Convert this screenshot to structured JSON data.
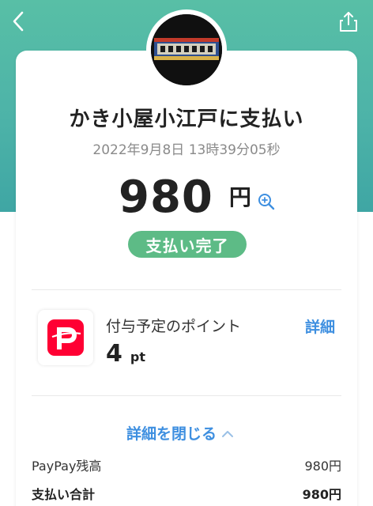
{
  "header": {
    "back_icon": "chevron-left-icon",
    "share_icon": "share-icon"
  },
  "merchant": {
    "title": "かき小屋小江戸に支払い",
    "logo_text": "かき小屋小江戸"
  },
  "transaction": {
    "timestamp": "2022年9月8日 13時39分05秒",
    "amount": "980",
    "currency": "円",
    "status": "支払い完了"
  },
  "points": {
    "label": "付与予定のポイント",
    "value": "4",
    "unit": "pt",
    "details_label": "詳細"
  },
  "details": {
    "toggle_label": "詳細を閉じる",
    "rows": [
      {
        "label": "PayPay残高",
        "value": "980円"
      },
      {
        "label": "支払い合計",
        "value": "980円"
      }
    ]
  },
  "colors": {
    "header_bg": "#4db3a8",
    "status_green": "#5dbb86",
    "link_blue": "#3e8fe0",
    "paypay_red": "#ff0033"
  }
}
